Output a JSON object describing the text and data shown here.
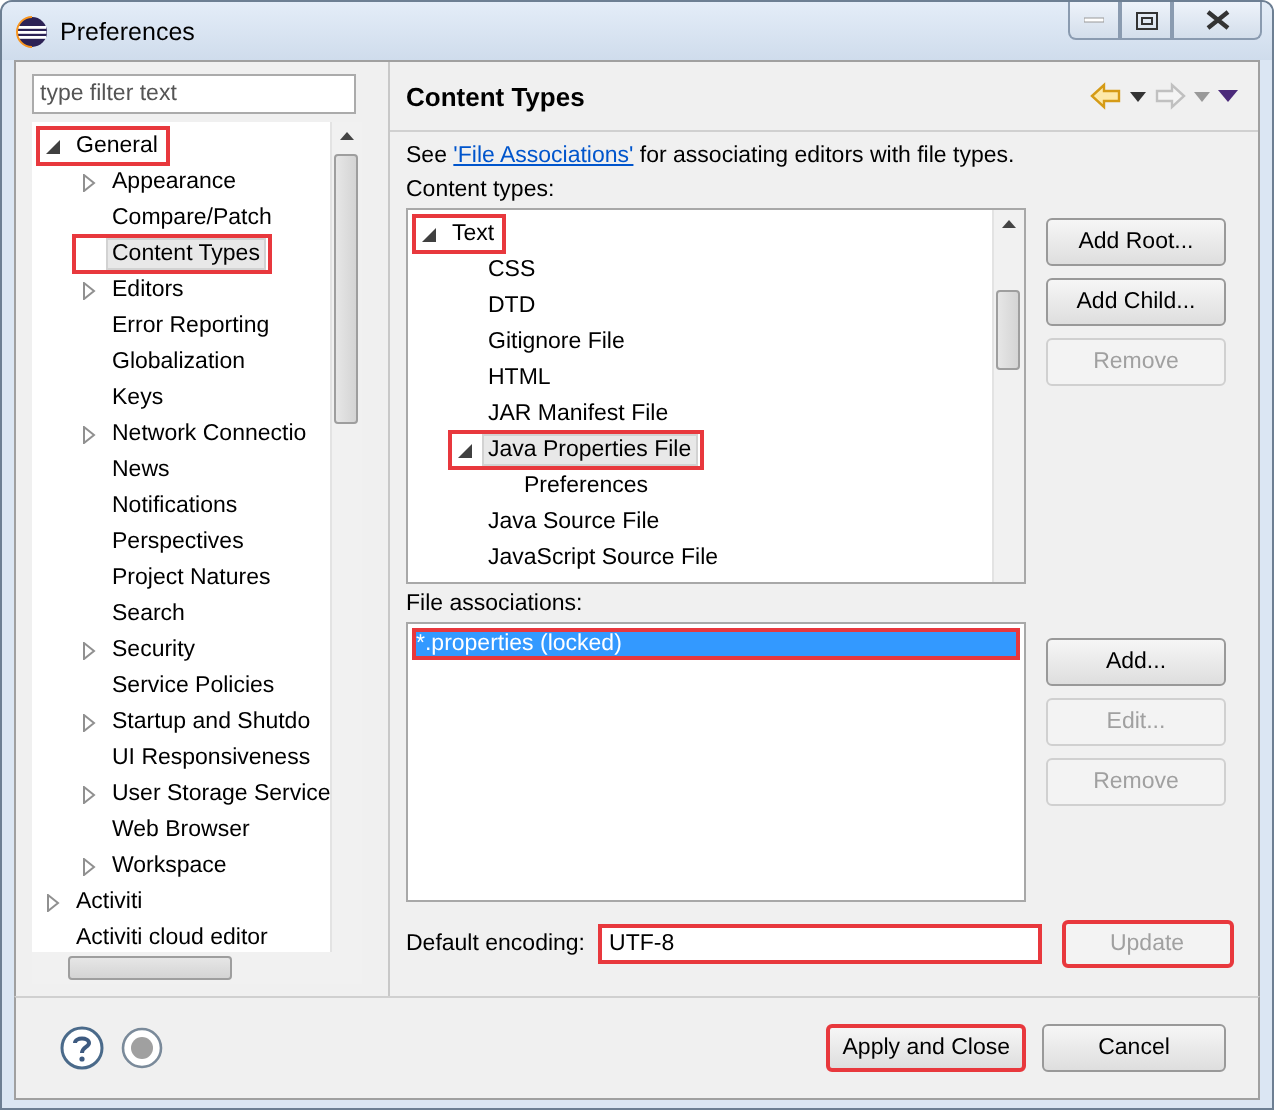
{
  "window": {
    "title": "Preferences"
  },
  "filter": {
    "placeholder": "type filter text"
  },
  "nav_tree": [
    {
      "label": "General",
      "expanded": true,
      "selected": false,
      "highlighted": true,
      "children": [
        {
          "label": "Appearance",
          "expanded": false,
          "selected": false,
          "highlighted": false
        },
        {
          "label": "Compare/Patch",
          "selected": false,
          "highlighted": false
        },
        {
          "label": "Content Types",
          "selected": true,
          "highlighted": true
        },
        {
          "label": "Editors",
          "expanded": false,
          "selected": false,
          "highlighted": false
        },
        {
          "label": "Error Reporting",
          "selected": false,
          "highlighted": false
        },
        {
          "label": "Globalization",
          "selected": false,
          "highlighted": false
        },
        {
          "label": "Keys",
          "selected": false,
          "highlighted": false
        },
        {
          "label": "Network Connectio",
          "expanded": false,
          "selected": false,
          "highlighted": false
        },
        {
          "label": "News",
          "selected": false,
          "highlighted": false
        },
        {
          "label": "Notifications",
          "selected": false,
          "highlighted": false
        },
        {
          "label": "Perspectives",
          "selected": false,
          "highlighted": false
        },
        {
          "label": "Project Natures",
          "selected": false,
          "highlighted": false
        },
        {
          "label": "Search",
          "selected": false,
          "highlighted": false
        },
        {
          "label": "Security",
          "expanded": false,
          "selected": false,
          "highlighted": false
        },
        {
          "label": "Service Policies",
          "selected": false,
          "highlighted": false
        },
        {
          "label": "Startup and Shutdo",
          "expanded": false,
          "selected": false,
          "highlighted": false
        },
        {
          "label": "UI Responsiveness",
          "selected": false,
          "highlighted": false
        },
        {
          "label": "User Storage Service",
          "expanded": false,
          "selected": false,
          "highlighted": false
        },
        {
          "label": "Web Browser",
          "selected": false,
          "highlighted": false
        },
        {
          "label": "Workspace",
          "expanded": false,
          "selected": false,
          "highlighted": false
        }
      ]
    },
    {
      "label": "Activiti",
      "expanded": false,
      "selected": false,
      "highlighted": false
    },
    {
      "label": "Activiti cloud editor",
      "selected": false,
      "highlighted": false
    }
  ],
  "page": {
    "title": "Content Types",
    "description": {
      "before": "See ",
      "link": "'File Associations'",
      "after": " for associating editors with file types."
    },
    "content_types_label": "Content types:",
    "content_types": [
      {
        "label": "Text",
        "expanded": true,
        "selected": false,
        "highlighted": true,
        "children": [
          {
            "label": "CSS",
            "selected": false,
            "highlighted": false
          },
          {
            "label": "DTD",
            "selected": false,
            "highlighted": false
          },
          {
            "label": "Gitignore File",
            "selected": false,
            "highlighted": false
          },
          {
            "label": "HTML",
            "selected": false,
            "highlighted": false
          },
          {
            "label": "JAR Manifest File",
            "selected": false,
            "highlighted": false
          },
          {
            "label": "Java Properties File",
            "expanded": true,
            "selected": true,
            "highlighted": true,
            "children": [
              {
                "label": "Preferences",
                "selected": false,
                "highlighted": false
              }
            ]
          },
          {
            "label": "Java Source File",
            "selected": false,
            "highlighted": false
          },
          {
            "label": "JavaScript Source File",
            "selected": false,
            "highlighted": false
          }
        ]
      }
    ],
    "content_type_buttons": [
      {
        "label": "Add Root...",
        "disabled": false
      },
      {
        "label": "Add Child...",
        "disabled": false
      },
      {
        "label": "Remove",
        "disabled": true
      }
    ],
    "file_associations_label": "File associations:",
    "file_associations": [
      {
        "label": "*.properties (locked)",
        "selected": true,
        "highlighted": true
      }
    ],
    "file_association_buttons": [
      {
        "label": "Add...",
        "disabled": false
      },
      {
        "label": "Edit...",
        "disabled": true
      },
      {
        "label": "Remove",
        "disabled": true
      }
    ],
    "encoding": {
      "label": "Default encoding:",
      "value": "UTF-8",
      "highlighted": true
    },
    "update_button": {
      "label": "Update",
      "disabled": true,
      "highlighted": true
    }
  },
  "footer_buttons": [
    {
      "label": "Apply and Close",
      "highlighted": true
    },
    {
      "label": "Cancel",
      "highlighted": false
    }
  ]
}
